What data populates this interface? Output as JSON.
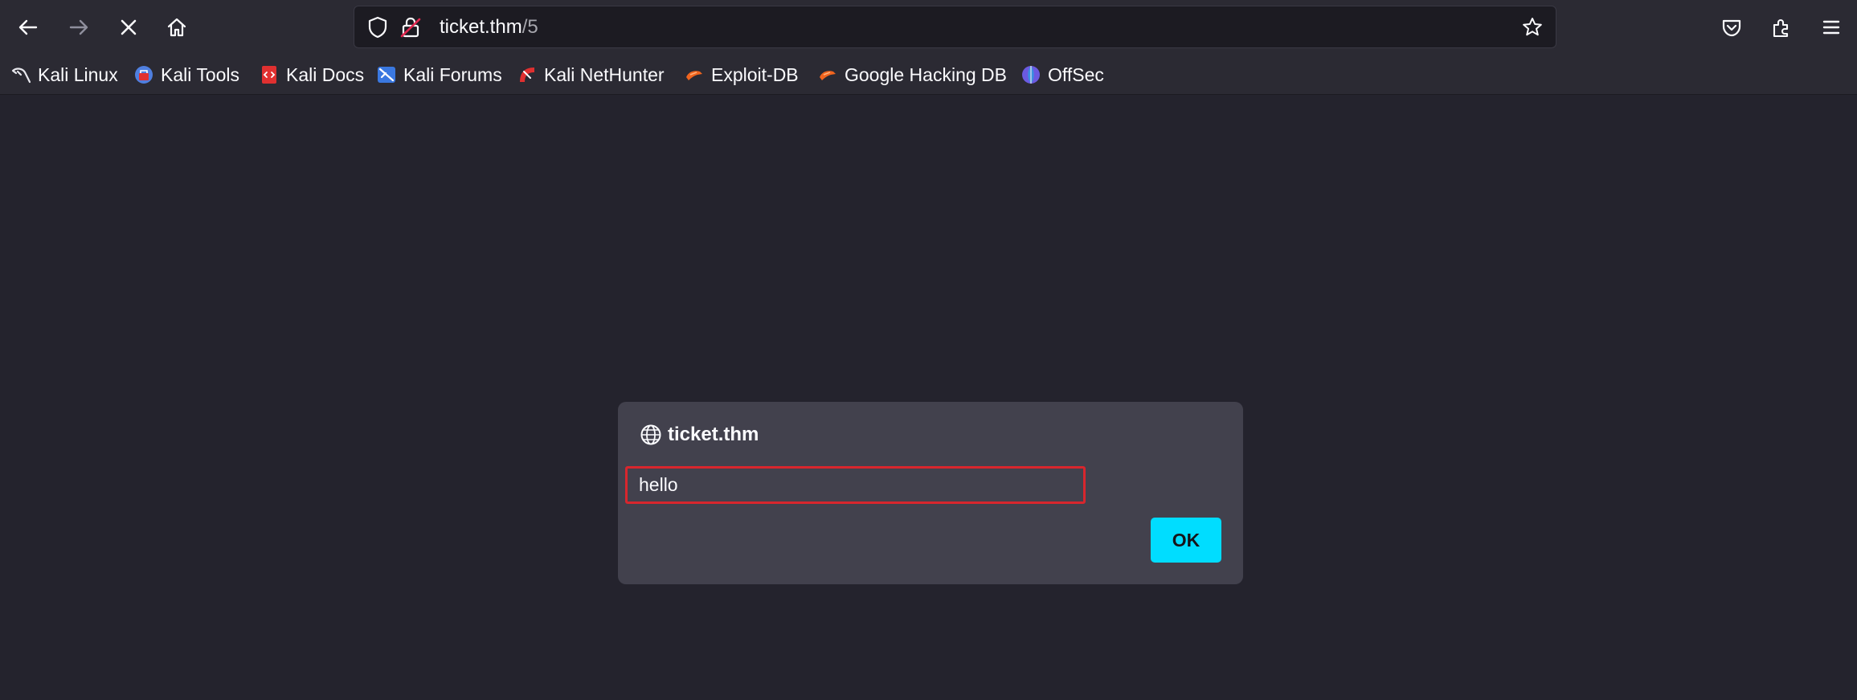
{
  "browser": {
    "url_host": "ticket.thm",
    "url_path": "/5"
  },
  "bookmarks": [
    {
      "label": "Kali Linux",
      "icon": "kali-linux-icon",
      "color": "#e8e8ee"
    },
    {
      "label": "Kali Tools",
      "icon": "kali-tools-icon",
      "color": "#4f7fe0"
    },
    {
      "label": "Kali Docs",
      "icon": "kali-docs-icon",
      "color": "#e03030"
    },
    {
      "label": "Kali Forums",
      "icon": "kali-forums-icon",
      "color": "#3a78e0"
    },
    {
      "label": "Kali NetHunter",
      "icon": "kali-nethunter-icon",
      "color": "#e03030"
    },
    {
      "label": "Exploit-DB",
      "icon": "exploit-db-icon",
      "color": "#f0641e"
    },
    {
      "label": "Google Hacking DB",
      "icon": "google-hacking-db-icon",
      "color": "#f0641e"
    },
    {
      "label": "OffSec",
      "icon": "offsec-icon",
      "color": "#6b5ae0"
    }
  ],
  "dialog": {
    "title": "ticket.thm",
    "input_value": "hello",
    "ok_label": "OK"
  },
  "colors": {
    "page_bg": "#24232d",
    "toolbar_bg": "#2b2a33",
    "dialog_bg": "#42414d",
    "accent": "#00ddff",
    "input_border": "#d8262d"
  }
}
